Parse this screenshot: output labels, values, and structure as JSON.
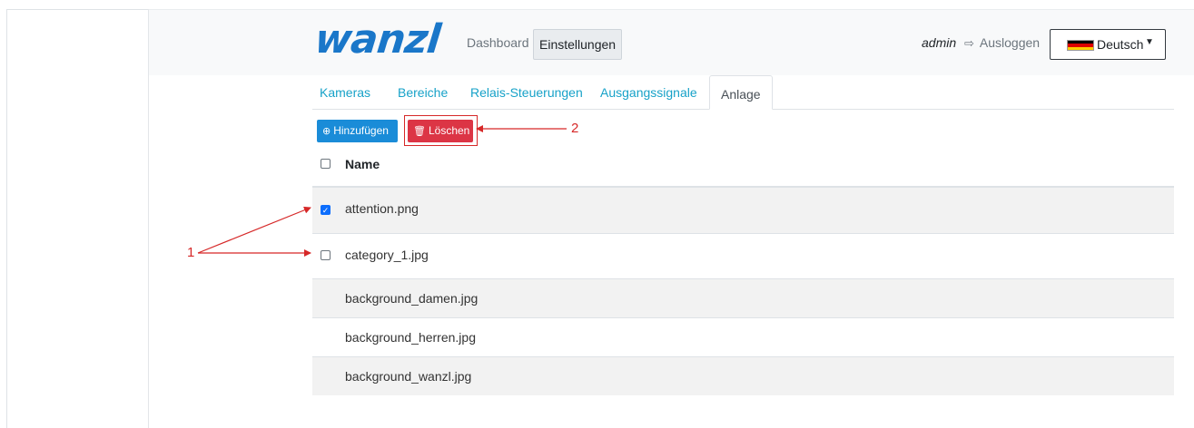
{
  "header": {
    "logo": "wanzl",
    "nav_dashboard": "Dashboard",
    "nav_settings": "Einstellungen",
    "user": "admin",
    "logout": "Ausloggen",
    "language": "Deutsch"
  },
  "tabs": [
    "Kameras",
    "Bereiche",
    "Relais-Steuerungen",
    "Ausgangssignale",
    "Anlage"
  ],
  "toolbar": {
    "add_label": "Hinzufügen",
    "delete_label": "Löschen"
  },
  "table": {
    "header_name": "Name",
    "rows": [
      {
        "name": "attention.png",
        "checked": true
      },
      {
        "name": "category_1.jpg",
        "checked": false
      },
      {
        "name": "background_damen.jpg"
      },
      {
        "name": "background_herren.jpg"
      },
      {
        "name": "background_wanzl.jpg"
      }
    ]
  },
  "annotations": {
    "callout_1": "1",
    "callout_2": "2"
  },
  "colors": {
    "primary": "#1a8cd8",
    "danger": "#dc3545",
    "link": "#17a2c8",
    "annotation": "#d62828"
  }
}
